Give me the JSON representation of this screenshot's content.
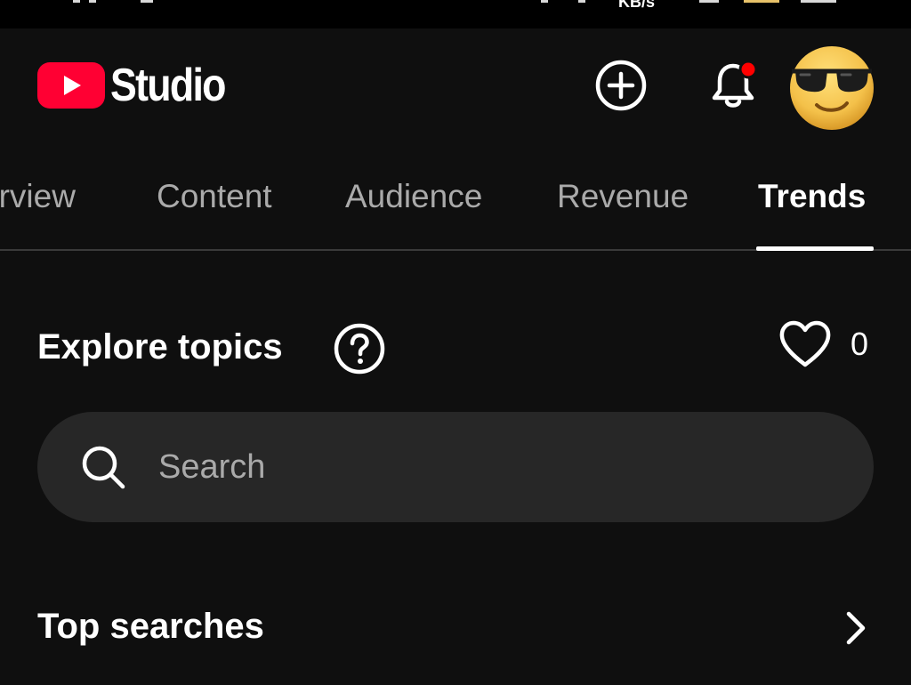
{
  "status_bar": {
    "partial_text": "KB/s"
  },
  "header": {
    "logo_text": "Studio",
    "colors": {
      "brand_red": "#ff0033",
      "notification_dot": "#ff0000"
    },
    "icons": {
      "create": "plus-circle-icon",
      "notifications": "bell-icon",
      "avatar": "sunglasses-emoji-avatar"
    }
  },
  "tabs": {
    "items": [
      {
        "label": "erview",
        "active": false
      },
      {
        "label": "Content",
        "active": false
      },
      {
        "label": "Audience",
        "active": false
      },
      {
        "label": "Revenue",
        "active": false
      },
      {
        "label": "Trends",
        "active": true
      }
    ]
  },
  "explore": {
    "title": "Explore topics",
    "favorites_count": "0",
    "icons": {
      "help": "question-circle-icon",
      "favorites": "heart-icon"
    }
  },
  "search": {
    "placeholder": "Search",
    "icon": "search-icon"
  },
  "top_searches": {
    "title": "Top searches",
    "icon": "chevron-right-icon"
  }
}
